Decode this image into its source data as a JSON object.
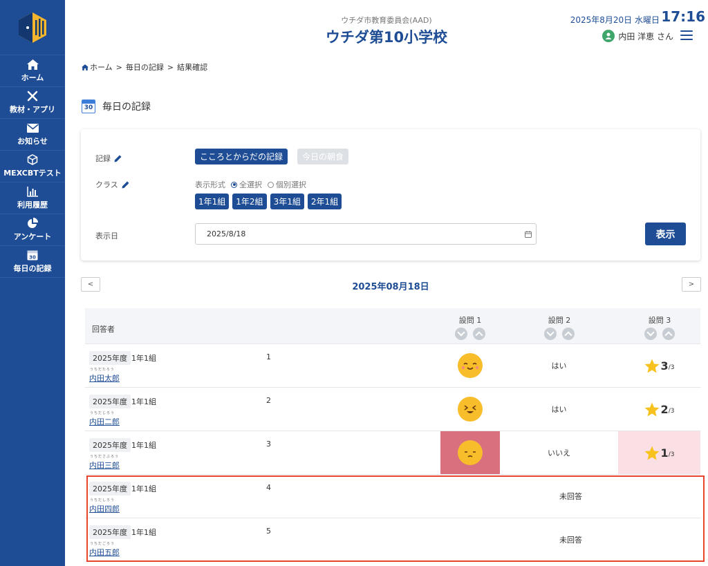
{
  "sidebar": {
    "items": [
      {
        "label": "ホーム",
        "icon": "home-icon"
      },
      {
        "label": "教材・アプリ",
        "icon": "tools-icon"
      },
      {
        "label": "お知らせ",
        "icon": "envelope-icon"
      },
      {
        "label": "MEXCBTテスト",
        "icon": "cube-icon"
      },
      {
        "label": "利用履歴",
        "icon": "bar-chart-icon"
      },
      {
        "label": "アンケート",
        "icon": "pie-chart-icon"
      },
      {
        "label": "毎日の記録",
        "icon": "calendar-icon"
      }
    ]
  },
  "header": {
    "subtitle": "ウチダ市教育委員会(AAD)",
    "title": "ウチダ第10小学校",
    "date": "2025年8月20日 水曜日",
    "time": "17:16",
    "user": "内田 洋恵 さん"
  },
  "breadcrumb": [
    "ホーム",
    "毎日の記録",
    "結果確認"
  ],
  "page": {
    "title": "毎日の記録",
    "icon_num": "30"
  },
  "form": {
    "record_label": "記録",
    "record_buttons": [
      "こころとからだの記録",
      "今日の朝食"
    ],
    "class_label": "クラス",
    "display_mode_label": "表示形式",
    "display_options": [
      "全選択",
      "個別選択"
    ],
    "classes": [
      "1年1組",
      "1年2組",
      "3年1組",
      "2年1組"
    ],
    "date_label": "表示日",
    "date_value": "2025/8/18",
    "submit_label": "表示"
  },
  "date_nav": {
    "prev": "<",
    "next": ">",
    "current": "2025年08月18日"
  },
  "table": {
    "respondent_header": "回答者",
    "questions": [
      "設問 1",
      "設問 2",
      "設問 3"
    ],
    "rows": [
      {
        "year": "2025年度",
        "class": "1年1組",
        "ruby": "うちだたろう",
        "name": "内田太郎",
        "num": "1",
        "q1": "smile",
        "q2": "はい",
        "q3_score": "3",
        "q3_max": "/3"
      },
      {
        "year": "2025年度",
        "class": "1年1組",
        "ruby": "うちだじろう",
        "name": "内田二郎",
        "num": "2",
        "q1": "grin",
        "q2": "はい",
        "q3_score": "2",
        "q3_max": "/3"
      },
      {
        "year": "2025年度",
        "class": "1年1組",
        "ruby": "うちださぶろう",
        "name": "内田三郎",
        "num": "3",
        "q1": "sad",
        "q2": "いいえ",
        "q3_score": "1",
        "q3_max": "/3"
      },
      {
        "year": "2025年度",
        "class": "1年1組",
        "ruby": "うちだしろう",
        "name": "内田四郎",
        "num": "4",
        "status": "未回答"
      },
      {
        "year": "2025年度",
        "class": "1年1組",
        "ruby": "うちだごろう",
        "name": "内田五郎",
        "num": "5",
        "status": "未回答"
      }
    ]
  },
  "colors": {
    "primary": "#1e4d95",
    "highlight": "#e8432c",
    "bad_cell": "#d9707e",
    "bad_cell_light": "#fadfe4",
    "face": "#f7bd2a",
    "star": "#f7c21d"
  }
}
